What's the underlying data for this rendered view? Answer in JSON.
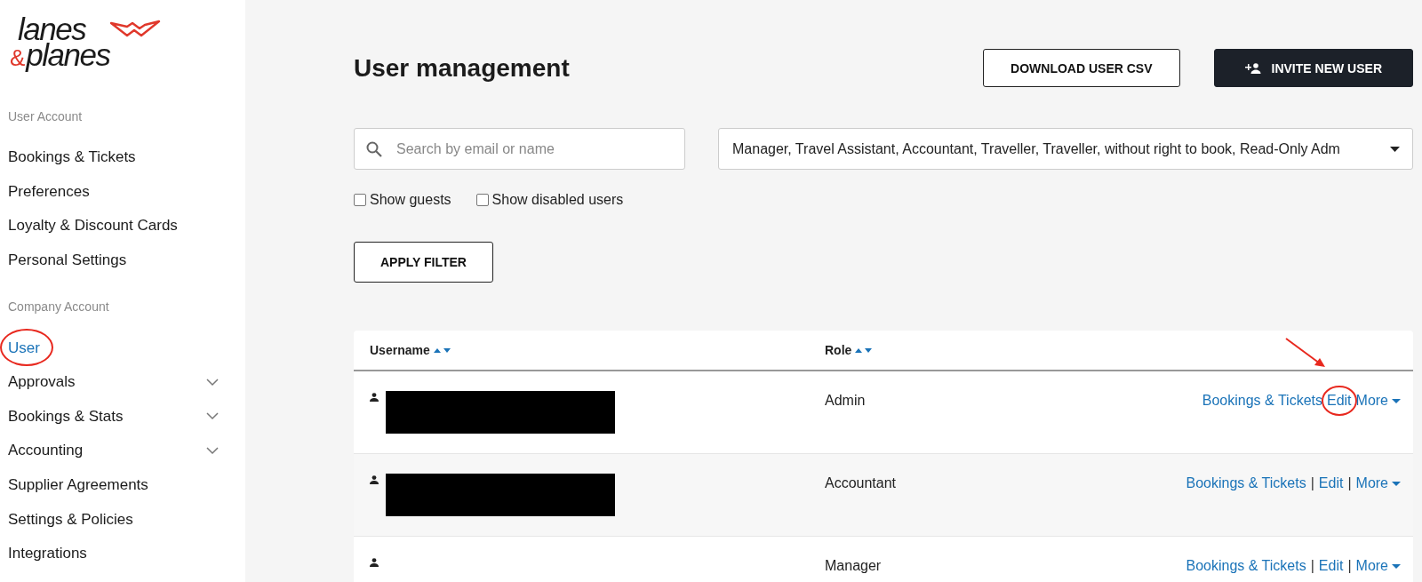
{
  "logo": {
    "line1": "lanes",
    "amp": "&",
    "line2": "planes"
  },
  "sidebar": {
    "sections": [
      {
        "title": "User Account",
        "items": [
          {
            "label": "Bookings & Tickets",
            "selected": false,
            "expandable": false,
            "circled": false
          },
          {
            "label": "Preferences",
            "selected": false,
            "expandable": false,
            "circled": false
          },
          {
            "label": "Loyalty & Discount Cards",
            "selected": false,
            "expandable": false,
            "circled": false
          },
          {
            "label": "Personal Settings",
            "selected": false,
            "expandable": false,
            "circled": false
          }
        ]
      },
      {
        "title": "Company Account",
        "items": [
          {
            "label": "User",
            "selected": true,
            "expandable": false,
            "circled": true
          },
          {
            "label": "Approvals",
            "selected": false,
            "expandable": true,
            "circled": false
          },
          {
            "label": "Bookings & Stats",
            "selected": false,
            "expandable": true,
            "circled": false
          },
          {
            "label": "Accounting",
            "selected": false,
            "expandable": true,
            "circled": false
          },
          {
            "label": "Supplier Agreements",
            "selected": false,
            "expandable": false,
            "circled": false
          },
          {
            "label": "Settings & Policies",
            "selected": false,
            "expandable": false,
            "circled": false
          },
          {
            "label": "Integrations",
            "selected": false,
            "expandable": false,
            "circled": false
          }
        ]
      }
    ]
  },
  "page": {
    "title": "User management",
    "buttons": [
      {
        "label": "DOWNLOAD USER CSV",
        "kind": "outline"
      },
      {
        "label": "INVITE NEW USER",
        "kind": "primary"
      }
    ]
  },
  "filters": {
    "search": {
      "placeholder": "Search by email or name"
    },
    "roles": {
      "value": "Manager, Travel Assistant, Accountant, Traveller, Traveller, without right to book, Read-Only Adm"
    },
    "checkboxes": [
      {
        "label": "Show guests",
        "checked": false
      },
      {
        "label": "Show disabled users",
        "checked": false
      }
    ],
    "apply": "APPLY FILTER"
  },
  "table": {
    "columns": [
      {
        "label": "Username",
        "sortable": true
      },
      {
        "label": "Role",
        "sortable": true
      }
    ],
    "rows": [
      {
        "redacted": true,
        "role": "Admin",
        "actions": [
          {
            "kind": "link",
            "label": "Bookings & Tickets",
            "circled": false
          },
          {
            "kind": "link",
            "label": "Edit",
            "circled": true
          },
          {
            "kind": "menu",
            "label": "More",
            "circled": false
          }
        ]
      },
      {
        "redacted": true,
        "role": "Accountant",
        "actions": [
          {
            "kind": "link",
            "label": "Bookings & Tickets",
            "circled": false
          },
          {
            "kind": "separator",
            "label": "|"
          },
          {
            "kind": "link",
            "label": "Edit",
            "circled": false
          },
          {
            "kind": "separator",
            "label": "|"
          },
          {
            "kind": "menu",
            "label": "More",
            "circled": false
          }
        ]
      },
      {
        "redacted": false,
        "role": "Manager",
        "actions": [
          {
            "kind": "link",
            "label": "Bookings & Tickets",
            "circled": false
          },
          {
            "kind": "separator",
            "label": "|"
          },
          {
            "kind": "link",
            "label": "Edit",
            "circled": false
          },
          {
            "kind": "separator",
            "label": "|"
          },
          {
            "kind": "menu",
            "label": "More",
            "circled": false
          }
        ]
      }
    ]
  }
}
